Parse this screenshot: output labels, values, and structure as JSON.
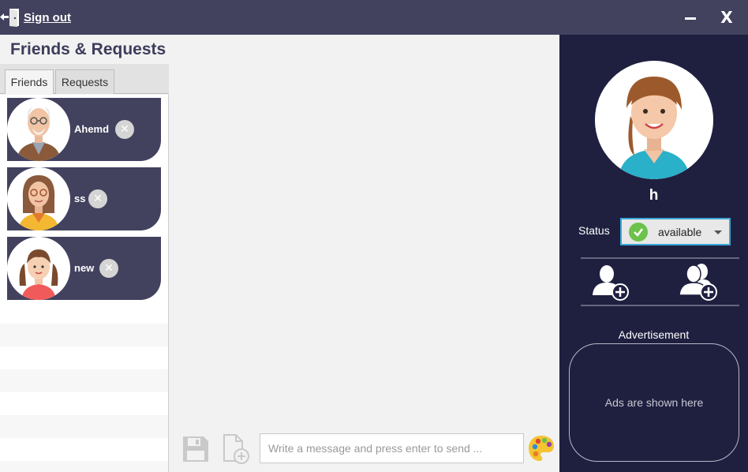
{
  "titlebar": {
    "signout_label": "Sign out",
    "signout_icon": "door-exit-icon",
    "minimize_icon": "minimize-icon",
    "close_label": "X"
  },
  "left_panel": {
    "title": "Friends & Requests",
    "tabs": [
      {
        "label": "Friends",
        "selected": true
      },
      {
        "label": "Requests",
        "selected": false
      }
    ],
    "friends": [
      {
        "name": "Ahemd",
        "avatar": "old-man-avatar"
      },
      {
        "name": "ss",
        "avatar": "woman-glasses-avatar"
      },
      {
        "name": "new",
        "avatar": "girl-avatar"
      }
    ]
  },
  "chat": {
    "input_placeholder": "Write a message and press enter to send ...",
    "input_value": "",
    "save_icon": "save-icon",
    "attach_icon": "attach-file-icon",
    "palette_icon": "palette-icon"
  },
  "right_panel": {
    "username": "h",
    "avatar": "woman-avatar",
    "status_label": "Status",
    "status_value": "available",
    "status_color": "#6cc24a",
    "add_friend_icon": "add-friend-icon",
    "add_group_icon": "add-group-icon",
    "ad_title": "Advertisement",
    "ad_text": "Ads are shown here"
  },
  "colors": {
    "titlebar": "#42425f",
    "sidebar_dark": "#1f2040",
    "friend_card": "#42425f",
    "accent": "#3aa6d8"
  }
}
